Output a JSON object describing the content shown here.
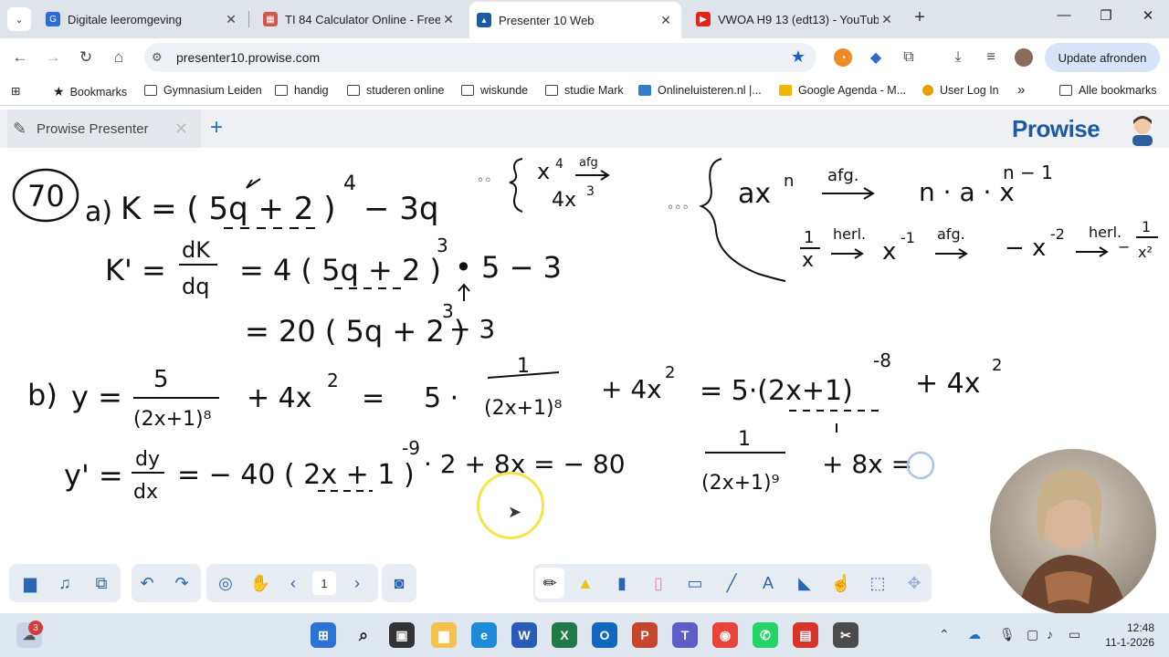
{
  "browser": {
    "tabs": [
      {
        "title": "Digitale leeromgeving",
        "fav_color": "#2c6bd8"
      },
      {
        "title": "TI 84 Calculator Online - Free G",
        "fav_color": "#d0574e"
      },
      {
        "title": "Presenter 10 Web",
        "fav_color": "#1d5aa6"
      },
      {
        "title": "VWOA H9 13 (edt13) - YouTube",
        "fav_color": "#e62117"
      }
    ],
    "active_tab": 2,
    "url": "presenter10.prowise.com",
    "update_label": "Update afronden"
  },
  "bookmarks": {
    "items": [
      "Bookmarks",
      "Gymnasium Leiden",
      "handig",
      "studeren online",
      "wiskunde",
      "studie Mark",
      "Onlineluisteren.nl |...",
      "Google Agenda - M...",
      "User Log In"
    ],
    "more": "»",
    "all": "Alle bookmarks"
  },
  "app": {
    "tab_label": "Prowise Presenter",
    "logo": "Prowise"
  },
  "board": {
    "problem_number": "70",
    "part_a_label": "a)",
    "a_line1": "K = ( 5q + 2 )",
    "a_line1_exp": "4",
    "a_line1_tail": "− 3q",
    "a_line2_lhs": "K' =",
    "a_line2_frac_num": "dK",
    "a_line2_frac_den": "dq",
    "a_line2_rhs": "= 4 ( 5q + 2 )",
    "a_line2_exp": "3",
    "a_line2_tail": "• 5 − 3",
    "a_line3": "= 20 ( 5q + 2 )",
    "a_line3_exp": "3",
    "a_line3_tail": "− 3",
    "note1_top": "x",
    "note1_top_exp": "4",
    "note1_arrow": "afg",
    "note1_bottom": "4x",
    "note1_bottom_exp": "3",
    "note2_lhs": "ax",
    "note2_lhs_exp": "n",
    "note2_arrow": "afg.",
    "note2_rhs": "n · a · x",
    "note2_rhs_exp": "n − 1",
    "note3_frac_num": "1",
    "note3_frac_den": "x",
    "note3_arrow1": "herl.",
    "note3_mid": "x",
    "note3_mid_exp": "-1",
    "note3_arrow2": "afg.",
    "note3_mid2": "− x",
    "note3_mid2_exp": "-2",
    "note3_arrow3": "herl.",
    "note3_end": "−",
    "note3_end_num": "1",
    "note3_end_den": "x²",
    "part_b_label": "b)",
    "b_line1_lhs": "y =",
    "b_frac_num": "5",
    "b_frac_den": "(2x+1)⁸",
    "b_plus": "+ 4x",
    "b_plus_exp": "2",
    "b_eq": "=",
    "b_five": "5 ·",
    "b_frac2_num": "1",
    "b_frac2_den": "(2x+1)⁸",
    "b_plus2": "+ 4x",
    "b_plus2_exp": "2",
    "b_eq2": "= 5·(2x+1)",
    "b_eq2_exp": "-8",
    "b_eq2_tail": "+ 4x",
    "b_eq2_tail_exp": "2",
    "b_line2_lhs": "y' =",
    "b_line2_frac_num": "dy",
    "b_line2_frac_den": "dx",
    "b_line2_rhs": "= − 40 ( 2x + 1 )",
    "b_line2_exp": "-9",
    "b_line2_tail": "· 2 + 8x = − 80",
    "b_line2_frac2_num": "1",
    "b_line2_frac2_den": "(2x+1)⁹",
    "b_line2_end": "+ 8x ="
  },
  "toolbar": {
    "page": "1"
  },
  "taskbar": {
    "notif_count": "3",
    "time": "12:48",
    "date": "11-1-2026"
  }
}
